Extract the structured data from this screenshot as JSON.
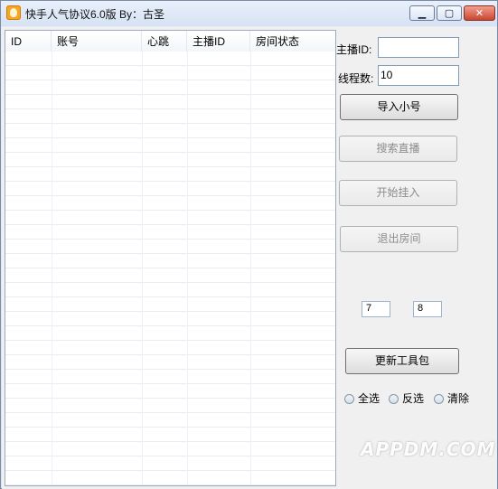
{
  "window": {
    "title": "快手人气协议6.0版   By：古圣",
    "controls": {
      "minimize": "▁",
      "maximize": "▢",
      "close": "✕"
    }
  },
  "table": {
    "columns": [
      "ID",
      "账号",
      "心跳",
      "主播ID",
      "房间状态"
    ],
    "rows": []
  },
  "form": {
    "anchor_id_label": "主播ID:",
    "anchor_id_value": "",
    "threads_label": "线程数:",
    "threads_value": "10"
  },
  "buttons": {
    "import": "导入小号",
    "search": "搜索直播",
    "start": "开始挂入",
    "exit": "退出房间",
    "update": "更新工具包"
  },
  "small_inputs": {
    "first": "7",
    "second": "8"
  },
  "radios": [
    "全选",
    "反选",
    "清除"
  ],
  "watermark": "APPDM.COM"
}
